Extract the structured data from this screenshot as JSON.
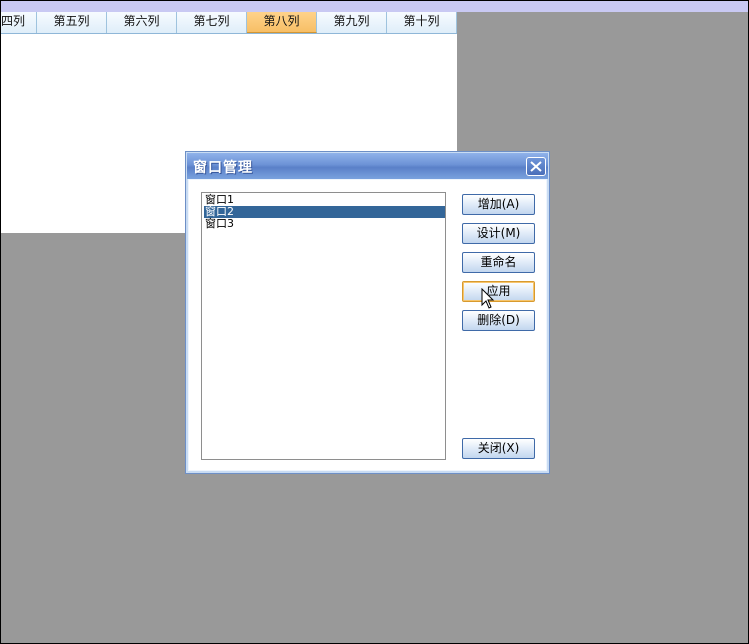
{
  "spreadsheet": {
    "columns": [
      {
        "label": "四列",
        "selected": false
      },
      {
        "label": "第五列",
        "selected": false
      },
      {
        "label": "第六列",
        "selected": false
      },
      {
        "label": "第七列",
        "selected": false
      },
      {
        "label": "第八列",
        "selected": true
      },
      {
        "label": "第九列",
        "selected": false
      },
      {
        "label": "第十列",
        "selected": false
      }
    ]
  },
  "dialog": {
    "title": "窗口管理",
    "list_items": [
      "窗口1",
      "窗口2",
      "窗口3"
    ],
    "selected_item": "窗口2",
    "buttons": {
      "add": "增加(A)",
      "design": "设计(M)",
      "rename": "重命名",
      "apply": "应用",
      "delete": "删除(D)",
      "close": "关闭(X)"
    }
  },
  "colors": {
    "background": "#999999",
    "selection": "#336699",
    "selected_column": "#f7bf66",
    "titlebar": "#6c92d6"
  }
}
